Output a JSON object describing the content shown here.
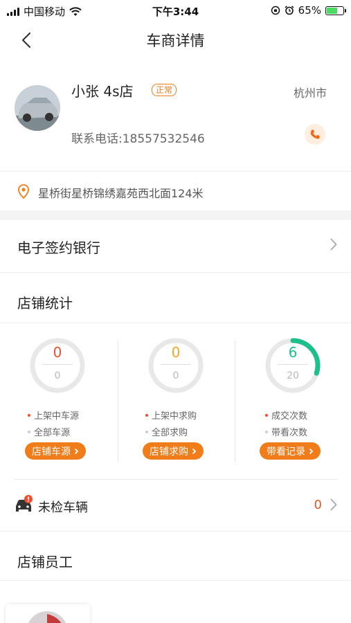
{
  "status_bar": {
    "carrier": "中国移动",
    "time": "下午3:44",
    "battery_percent": "65%",
    "battery_level": 0.65
  },
  "nav": {
    "title": "车商详情"
  },
  "dealer": {
    "name": "小张 4s店",
    "status_badge": "正常",
    "city": "杭州市",
    "phone_text": "联系电话:18557532546"
  },
  "address": {
    "text": "星桥街星桥锦绣嘉苑西北面124米"
  },
  "e_sign_bank": {
    "label": "电子签约银行"
  },
  "store_stats": {
    "title": "店铺统计",
    "columns": [
      {
        "top_value": "0",
        "bottom_value": "0",
        "progress": 0,
        "color": "#f04e2e",
        "legend_active": "上架中车源",
        "legend_total": "全部车源",
        "button": "店铺车源"
      },
      {
        "top_value": "0",
        "bottom_value": "0",
        "progress": 0,
        "color": "#f5a623",
        "legend_active": "上架中求购",
        "legend_total": "全部求购",
        "button": "店铺求购"
      },
      {
        "top_value": "6",
        "bottom_value": "20",
        "progress": 0.3,
        "color": "#1dbf8a",
        "legend_active": "成交次数",
        "legend_total": "带看次数",
        "button": "带看记录"
      }
    ]
  },
  "unchecked_vehicles": {
    "label": "未检车辆",
    "count": "0"
  },
  "staff": {
    "title": "店铺员工"
  },
  "colors": {
    "accent": "#f07d1a",
    "ring_track": "#e8e8e8",
    "legend_dot_active": "#f04e2e",
    "legend_dot_total": "#cccccc"
  }
}
